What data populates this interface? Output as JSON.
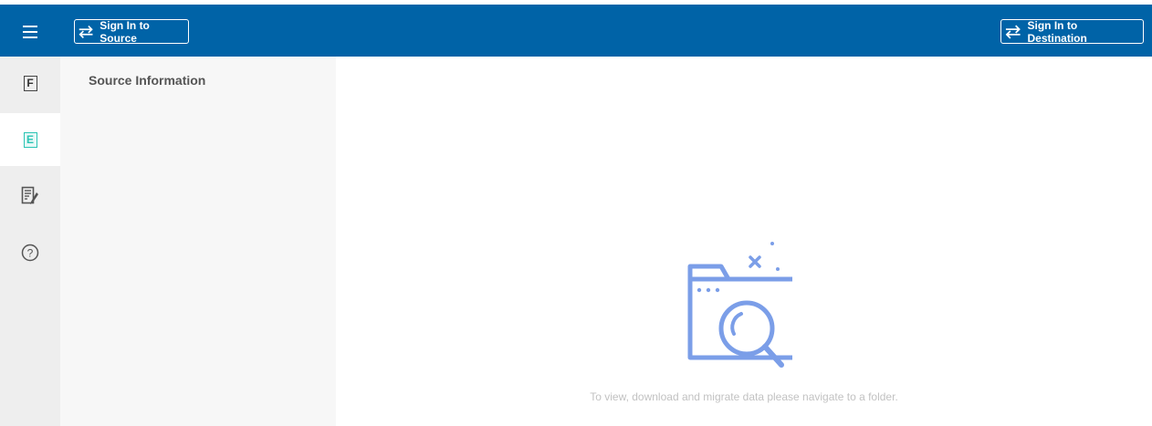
{
  "header": {
    "menu_icon": "hamburger-menu-icon",
    "sign_in_source_label": "Sign In to Source",
    "sign_in_destination_label": "Sign In to Destination",
    "swap_icon": "swap-arrows-icon",
    "background_color": "#0063a7"
  },
  "sidebar": {
    "items": [
      {
        "icon": "f-letter-icon",
        "letter": "F",
        "active": false
      },
      {
        "icon": "e-letter-icon",
        "letter": "E",
        "active": true
      },
      {
        "icon": "report-document-icon",
        "active": false
      },
      {
        "icon": "help-question-icon",
        "symbol": "?",
        "active": false
      }
    ],
    "accent_color": "#2bc4b4"
  },
  "source_panel": {
    "title": "Source Information"
  },
  "main": {
    "empty_state_icon": "folder-search-icon",
    "empty_message": "To view, download and migrate data please navigate to a folder.",
    "illustration_color": "#7b9ee8"
  }
}
